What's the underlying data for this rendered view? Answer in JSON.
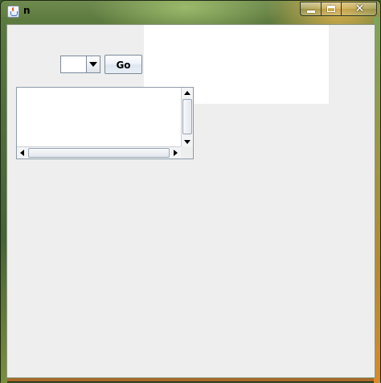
{
  "window": {
    "title": "n",
    "icons": {
      "app": "java-cup-icon",
      "minimize": "minimize-icon",
      "maximize": "maximize-icon",
      "close": "close-icon"
    },
    "close_glyph": "✕"
  },
  "controls": {
    "combo": {
      "selected": "",
      "arrow_icon": "chevron-down-icon"
    },
    "go_button": {
      "label": "Go"
    },
    "text_area": {
      "value": ""
    }
  },
  "colors": {
    "client_background": "#eeeeee",
    "panel_background": "#ffffff"
  }
}
